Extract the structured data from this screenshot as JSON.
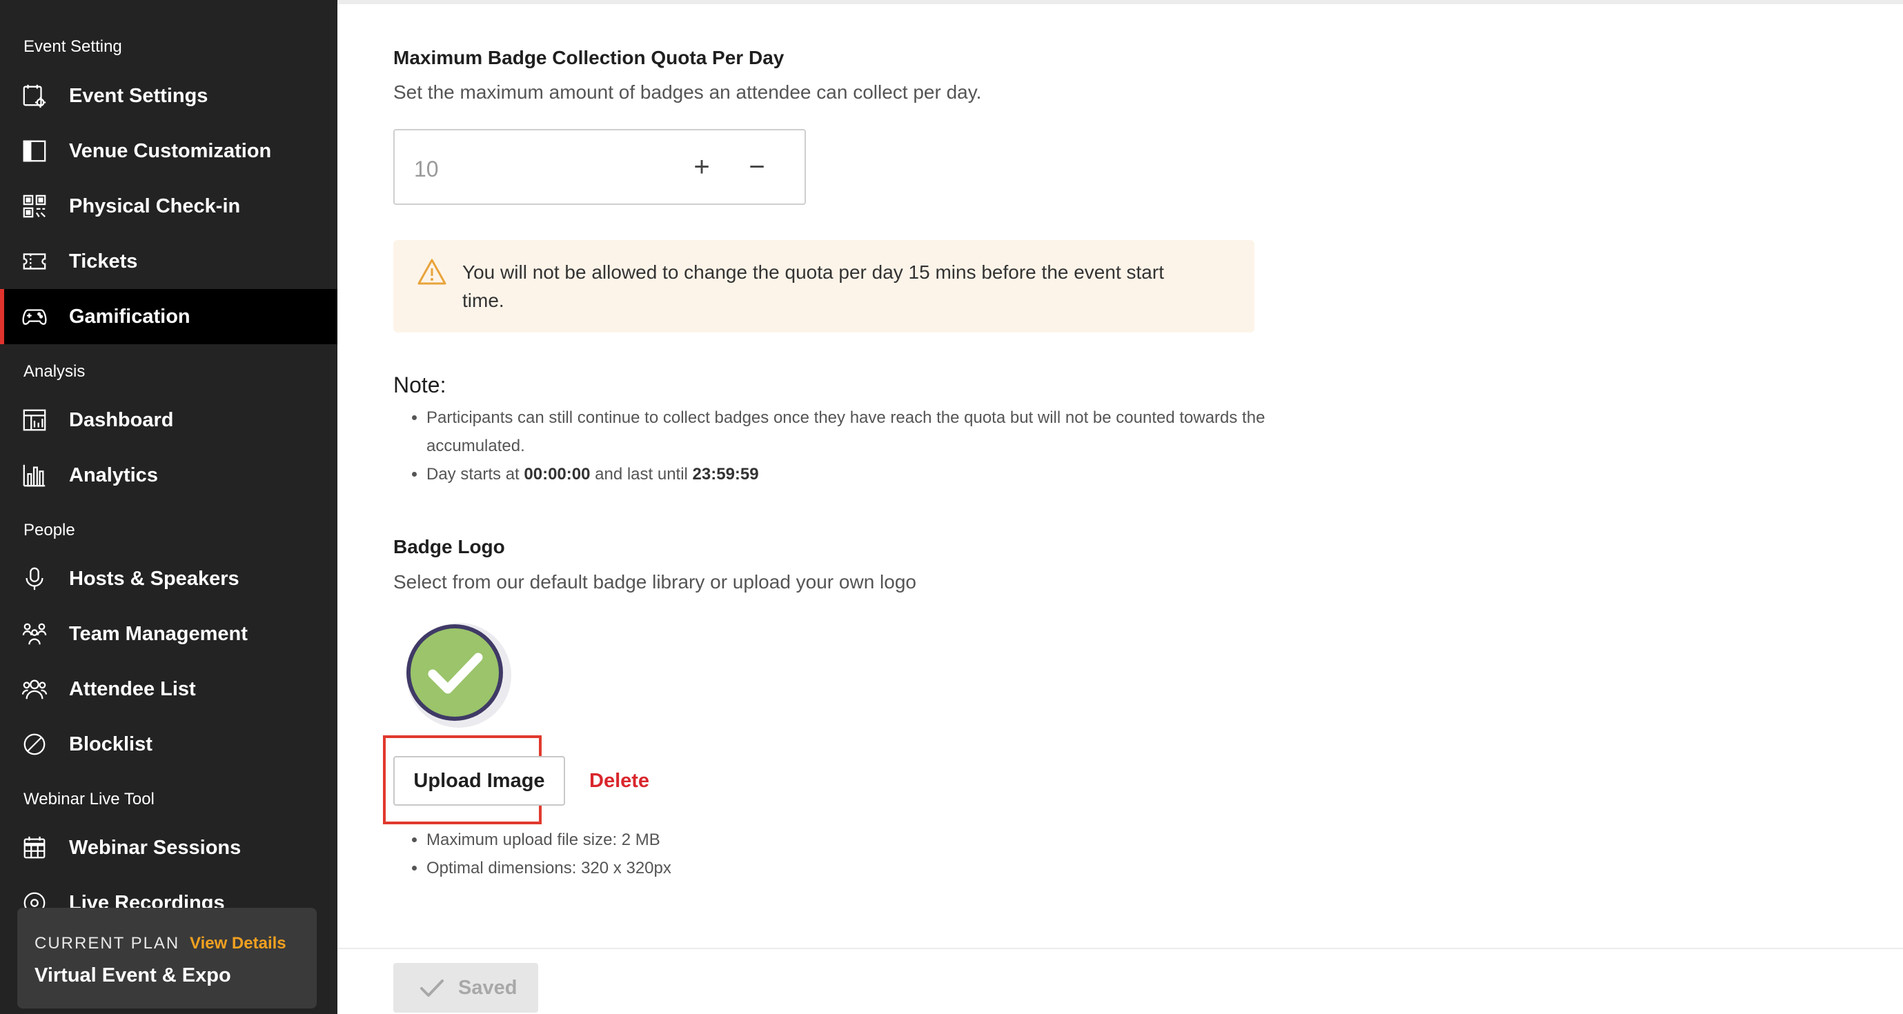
{
  "sidebar": {
    "sections": [
      {
        "label": "Event Setting"
      },
      {
        "label": "Analysis"
      },
      {
        "label": "People"
      },
      {
        "label": "Webinar Live Tool"
      }
    ],
    "items": [
      {
        "label": "Event Settings",
        "icon": "calendar-gear-icon"
      },
      {
        "label": "Venue Customization",
        "icon": "layout-icon"
      },
      {
        "label": "Physical Check-in",
        "icon": "qr-code-icon"
      },
      {
        "label": "Tickets",
        "icon": "ticket-icon"
      },
      {
        "label": "Gamification",
        "icon": "gamepad-icon",
        "active": true
      },
      {
        "label": "Dashboard",
        "icon": "dashboard-icon"
      },
      {
        "label": "Analytics",
        "icon": "bar-chart-icon"
      },
      {
        "label": "Hosts & Speakers",
        "icon": "microphone-icon"
      },
      {
        "label": "Team Management",
        "icon": "team-icon"
      },
      {
        "label": "Attendee List",
        "icon": "users-icon"
      },
      {
        "label": "Blocklist",
        "icon": "block-icon"
      },
      {
        "label": "Webinar Sessions",
        "icon": "calendar-grid-icon"
      },
      {
        "label": "Live Recordings",
        "icon": "record-icon"
      }
    ],
    "plan": {
      "label": "CURRENT PLAN",
      "link": "View Details",
      "name": "Virtual Event & Expo"
    }
  },
  "quota": {
    "title": "Maximum Badge Collection Quota Per Day",
    "description": "Set the maximum amount of badges an attendee can collect per day.",
    "value": "10",
    "plus": "+",
    "minus": "−"
  },
  "warning": {
    "text": "You will not be allowed to change the quota per day 15 mins before the event start time.",
    "color": "#fdf4e9",
    "icon_color": "#e8a33b"
  },
  "note": {
    "title": "Note:",
    "bullet1": "Participants can still continue to collect badges once they have reach the quota but will not be counted towards the accumulated.",
    "bullet2_prefix": "Day starts at ",
    "bullet2_start": "00:00:00",
    "bullet2_middle": " and last until ",
    "bullet2_end": "23:59:59"
  },
  "badge_logo": {
    "title": "Badge Logo",
    "description": "Select from our default badge library or upload your own logo",
    "upload_label": "Upload Image",
    "delete_label": "Delete",
    "hint1": "Maximum upload file size: 2 MB",
    "hint2": "Optimal dimensions: 320 x 320px",
    "badge_color": "#9bc46b"
  },
  "footer": {
    "saved_label": "Saved"
  },
  "colors": {
    "accent_red": "#e0332d",
    "link_orange": "#f0a020",
    "delete_red": "#d9262c"
  }
}
